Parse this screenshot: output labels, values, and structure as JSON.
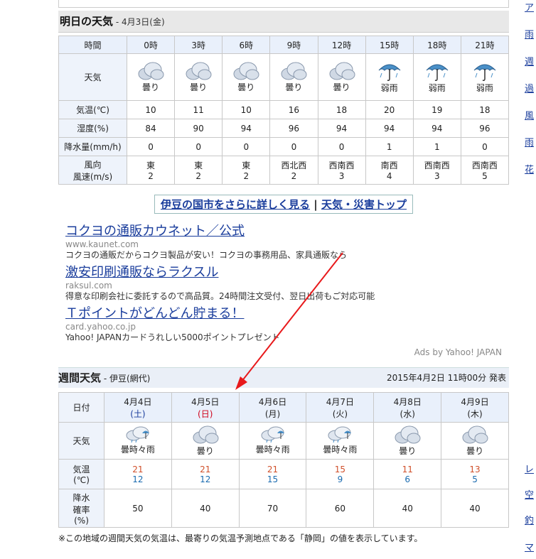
{
  "tomorrow": {
    "title": "明日の天気",
    "date": "- 4月3日(金)",
    "row_labels": {
      "time": "時間",
      "weather": "天気",
      "temp": "気温(℃)",
      "humidity": "湿度(%)",
      "precip": "降水量(mm/h)",
      "wind1": "風向",
      "wind2": "風速(m/s)"
    },
    "hours": [
      {
        "time": "0時",
        "icon": "cloud-icon",
        "weather": "曇り",
        "temp": "10",
        "humidity": "84",
        "precip": "0",
        "dir": "東",
        "speed": "2"
      },
      {
        "time": "3時",
        "icon": "cloud-icon",
        "weather": "曇り",
        "temp": "11",
        "humidity": "90",
        "precip": "0",
        "dir": "東",
        "speed": "2"
      },
      {
        "time": "6時",
        "icon": "cloud-icon",
        "weather": "曇り",
        "temp": "10",
        "humidity": "94",
        "precip": "0",
        "dir": "東",
        "speed": "2"
      },
      {
        "time": "9時",
        "icon": "cloud-icon",
        "weather": "曇り",
        "temp": "16",
        "humidity": "96",
        "precip": "0",
        "dir": "西北西",
        "speed": "2"
      },
      {
        "time": "12時",
        "icon": "cloud-icon",
        "weather": "曇り",
        "temp": "18",
        "humidity": "94",
        "precip": "0",
        "dir": "西南西",
        "speed": "3"
      },
      {
        "time": "15時",
        "icon": "umbrella-icon",
        "weather": "弱雨",
        "temp": "20",
        "humidity": "94",
        "precip": "1",
        "dir": "南西",
        "speed": "4"
      },
      {
        "time": "18時",
        "icon": "umbrella-icon",
        "weather": "弱雨",
        "temp": "19",
        "humidity": "94",
        "precip": "1",
        "dir": "西南西",
        "speed": "3"
      },
      {
        "time": "21時",
        "icon": "umbrella-icon",
        "weather": "弱雨",
        "temp": "18",
        "humidity": "96",
        "precip": "0",
        "dir": "西南西",
        "speed": "5"
      }
    ]
  },
  "links": {
    "more": "伊豆の国市をさらに詳しく見る",
    "sep": " | ",
    "top": "天気・災害トップ"
  },
  "ads": [
    {
      "title": "コクヨの通販カウネット／公式",
      "url": "www.kaunet.com",
      "desc": "コクヨの通販だからコクヨ製品が安い！コクヨの事務用品、家具通販なら"
    },
    {
      "title": "激安印刷通販ならラクスル",
      "url": "raksul.com",
      "desc": "得意な印刷会社に委託するので高品質。24時間注文受付、翌日出荷もご対応可能"
    },
    {
      "title": "Ｔポイントがどんどん貯まる！",
      "url": "card.yahoo.co.jp",
      "desc": "Yahoo! JAPANカードうれしい5000ポイントプレゼント"
    }
  ],
  "ads_by": "Ads by Yahoo! JAPAN",
  "weekly": {
    "title": "週間天気",
    "area": "- 伊豆(網代)",
    "published": "2015年4月2日 11時00分 発表",
    "row_labels": {
      "date": "日付",
      "weather": "天気",
      "temp1": "気温",
      "temp2": "(℃)",
      "rain1": "降水",
      "rain2": "確率",
      "rain3": "(%)"
    },
    "days": [
      {
        "date": "4月4日",
        "dow": "(土)",
        "dowclass": "sat",
        "icon": "cloud-rain-icon",
        "weather": "曇時々雨",
        "hi": "21",
        "lo": "12",
        "pop": "50"
      },
      {
        "date": "4月5日",
        "dow": "(日)",
        "dowclass": "sun",
        "icon": "cloud-icon",
        "weather": "曇り",
        "hi": "21",
        "lo": "12",
        "pop": "40"
      },
      {
        "date": "4月6日",
        "dow": "(月)",
        "dowclass": "",
        "icon": "cloud-rain-icon",
        "weather": "曇時々雨",
        "hi": "21",
        "lo": "15",
        "pop": "70"
      },
      {
        "date": "4月7日",
        "dow": "(火)",
        "dowclass": "",
        "icon": "cloud-rain-icon",
        "weather": "曇時々雨",
        "hi": "15",
        "lo": "9",
        "pop": "60"
      },
      {
        "date": "4月8日",
        "dow": "(水)",
        "dowclass": "",
        "icon": "cloud-icon",
        "weather": "曇り",
        "hi": "11",
        "lo": "6",
        "pop": "40"
      },
      {
        "date": "4月9日",
        "dow": "(木)",
        "dowclass": "",
        "icon": "cloud-icon",
        "weather": "曇り",
        "hi": "13",
        "lo": "5",
        "pop": "40"
      }
    ],
    "note": "※この地域の週間天気の気温は、最寄りの気温予測地点である「静岡」の値を表示しています。"
  },
  "sidebar": [
    "ア",
    "雨",
    "週",
    "過",
    "風",
    "雨",
    "花",
    "レ",
    "空",
    "釣",
    "マ"
  ],
  "colors": {
    "annotation_arrow": "#e8191b",
    "link": "#1a3d9c"
  }
}
